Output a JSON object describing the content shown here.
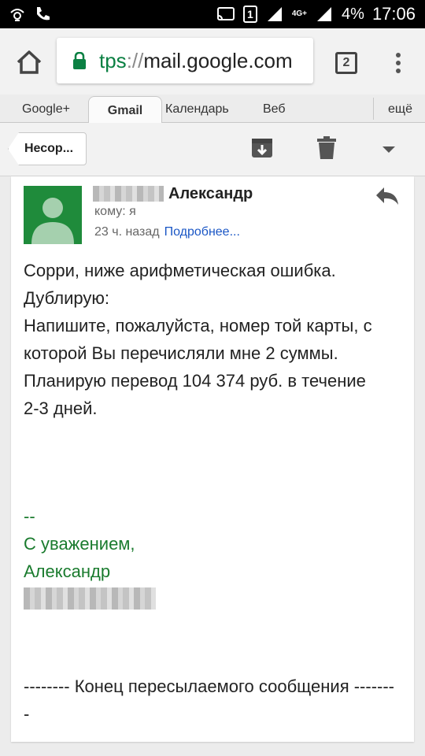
{
  "status_bar": {
    "sim_badge": "1",
    "network": "4G+",
    "battery": "4%",
    "time": "17:06"
  },
  "browser": {
    "url_scheme": "tps",
    "url_sep": "://",
    "url_host": "mail.google.com",
    "tab_count": "2"
  },
  "google_nav": {
    "items": [
      "Google+",
      "Gmail",
      "Календарь",
      "Веб"
    ],
    "more": "ещё"
  },
  "actionbar": {
    "back_label": "Несор..."
  },
  "message": {
    "sender_name": "Александр",
    "to_line": "кому: я",
    "time_ago": "23 ч. назад",
    "details_link": "Подробнее...",
    "body_lines": [
      "Сорри, ниже арифметическая ошибка.",
      "Дублирую:",
      "Напишите, пожалуйста, номер той карты, с",
      "которой Вы перечисляли мне 2 суммы.",
      "Планирую перевод 104 374 руб. в течение",
      "2-3 дней."
    ],
    "signature_lines": [
      "--",
      "С уважением,",
      "Александр"
    ],
    "forward_line_1": "-------- Конец пересылаемого сообщения -------",
    "forward_line_2": "-"
  },
  "colors": {
    "accent_green": "#1a7b2e",
    "link_blue": "#1a56c5",
    "avatar_green": "#1f8b3b"
  }
}
